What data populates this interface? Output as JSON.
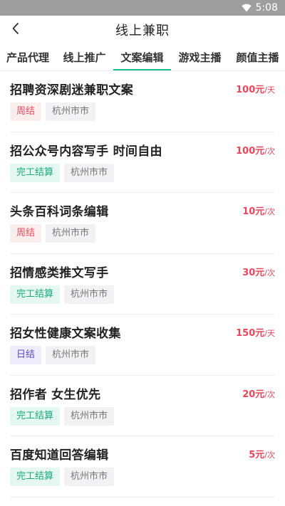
{
  "status_bar": {
    "time": "5:08",
    "icons": [
      "wifi-icon",
      "battery-icon"
    ]
  },
  "header": {
    "title": "线上兼职",
    "back_icon": "back-chevron-icon"
  },
  "tabs": [
    {
      "label": "产品代理",
      "active": false
    },
    {
      "label": "线上推广",
      "active": false
    },
    {
      "label": "文案编辑",
      "active": true
    },
    {
      "label": "游戏主播",
      "active": false
    },
    {
      "label": "颜值主播",
      "active": false
    }
  ],
  "colors": {
    "accent": "#1cc08f",
    "price": "#e8465a",
    "weekly": "#e8465a",
    "done": "#1aa97c",
    "daily": "#5b48c6"
  },
  "jobs": [
    {
      "title": "招聘资深剧迷兼职文案",
      "price": "100元",
      "unit": "/天",
      "pay": "周结",
      "pay_type": "weekly",
      "city": "杭州市市"
    },
    {
      "title": "招公众号内容写手 时间自由",
      "price": "100元",
      "unit": "/次",
      "pay": "完工结算",
      "pay_type": "done",
      "city": "杭州市市"
    },
    {
      "title": "头条百科词条编辑",
      "price": "10元",
      "unit": "/次",
      "pay": "周结",
      "pay_type": "weekly",
      "city": "杭州市市"
    },
    {
      "title": "招情感类推文写手",
      "price": "30元",
      "unit": "/次",
      "pay": "完工结算",
      "pay_type": "done",
      "city": "杭州市市"
    },
    {
      "title": "招女性健康文案收集",
      "price": "150元",
      "unit": "/天",
      "pay": "日结",
      "pay_type": "daily",
      "city": "杭州市市"
    },
    {
      "title": "招作者 女生优先",
      "price": "20元",
      "unit": "/次",
      "pay": "完工结算",
      "pay_type": "done",
      "city": "杭州市市"
    },
    {
      "title": "百度知道回答编辑",
      "price": "5元",
      "unit": "/次",
      "pay": "完工结算",
      "pay_type": "done",
      "city": "杭州市市"
    }
  ]
}
